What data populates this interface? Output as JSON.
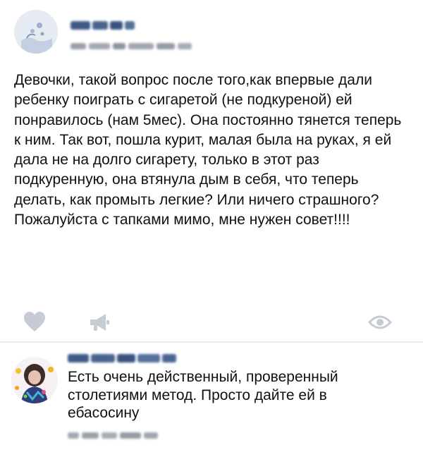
{
  "post": {
    "author_avatar_icon": "user-avatar",
    "text": "Девочки, такой вопрос после того,как впервые дали ребенку поиграть с сигаретой (не подкуреной) ей понравилось (нам 5мес). Она постоянно тянется теперь к ним. Так вот, пошла курит, малая была на руках, я ей дала не на долго сигарету, только в этот раз подкуренную, она втянула дым в себя, что теперь делать, как промыть легкие? Или ничего страшного? Пожалуйста с тапками мимо, мне нужен совет!!!!",
    "actions": {
      "like_icon": "heart-icon",
      "share_icon": "megaphone-icon",
      "views_icon": "eye-icon"
    }
  },
  "comment": {
    "author_avatar_icon": "user-avatar",
    "text": "Есть очень действенный, проверенный столетиями метод. Просто дайте ей в ебасосину"
  },
  "colors": {
    "icon_gray": "#c6ccd4",
    "divider": "#ececec",
    "blur_blue": "#3f5a86",
    "blur_gray": "#9aa1ab"
  }
}
